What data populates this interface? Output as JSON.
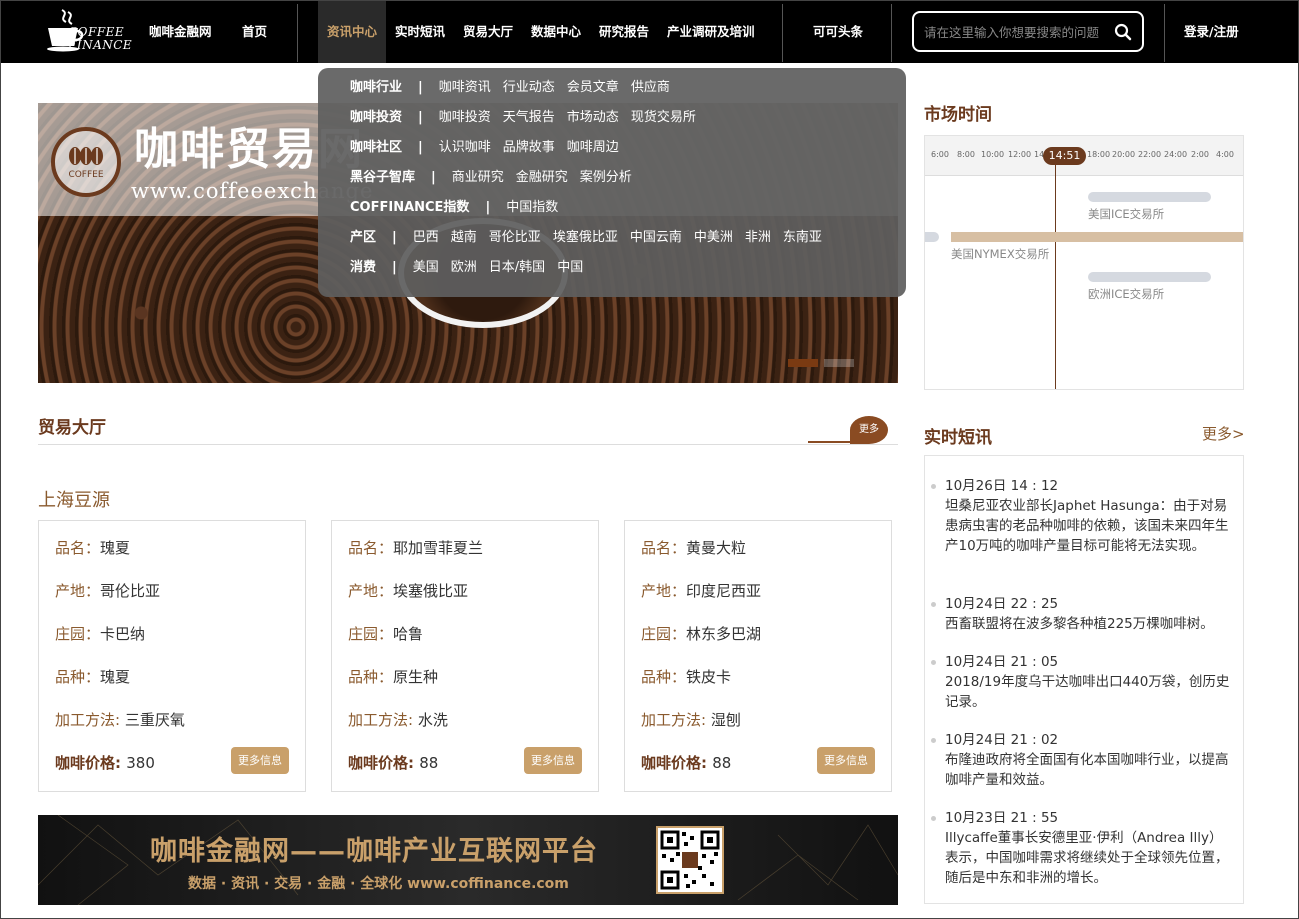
{
  "nav": {
    "logo_line1": "COFFEE",
    "logo_line2": "FINANCE",
    "site_name": "咖啡金融网",
    "home": "首页",
    "news_center": "资讯中心",
    "flash": "实时短讯",
    "trade_hall": "贸易大厅",
    "data_center": "数据中心",
    "research": "研究报告",
    "industry": "产业调研及培训",
    "keke": "可可头条",
    "search_placeholder": "请在这里输入你想要搜索的问题",
    "login": "登录/注册"
  },
  "dropdown": [
    {
      "cat": "咖啡行业",
      "links": [
        "咖啡资讯",
        "行业动态",
        "会员文章",
        "供应商"
      ]
    },
    {
      "cat": "咖啡投资",
      "links": [
        "咖啡投资",
        "天气报告",
        "市场动态",
        "现货交易所"
      ]
    },
    {
      "cat": "咖啡社区",
      "links": [
        "认识咖啡",
        "品牌故事",
        "咖啡周边"
      ]
    },
    {
      "cat": "黑谷子智库",
      "links": [
        "商业研究",
        "金融研究",
        "案例分析"
      ]
    },
    {
      "cat": "COFFINANCE指数",
      "links": [
        "中国指数"
      ]
    },
    {
      "cat": "产区",
      "links": [
        "巴西",
        "越南",
        "哥伦比亚",
        "埃塞俄比亚",
        "中国云南",
        "中美洲",
        "非洲",
        "东南亚"
      ]
    },
    {
      "cat": "消费",
      "links": [
        "美国",
        "欧洲",
        "日本/韩国",
        "中国"
      ]
    }
  ],
  "banner": {
    "title": "咖啡贸易网",
    "url": "www.coffeeexchange",
    "logo_text": "COFFEE"
  },
  "market_time": {
    "title": "市场时间",
    "ticks": [
      "6:00",
      "8:00",
      "10:00",
      "12:00",
      "14",
      "18:00",
      "20:00",
      "22:00",
      "24:00",
      "2:00",
      "4:00"
    ],
    "now": "14:51",
    "exchanges": [
      "美国ICE交易所",
      "美国NYMEX交易所",
      "欧洲ICE交易所"
    ]
  },
  "trade": {
    "title": "贸易大厅",
    "more": "更多",
    "subtitle": "上海豆源",
    "labels": {
      "name": "品名：",
      "origin": "产地：",
      "estate": "庄园：",
      "variety": "品种：",
      "process": "加工方法: ",
      "price": "咖啡价格: ",
      "more_btn": "更多信息"
    },
    "cards": [
      {
        "name": "瑰夏",
        "origin": "哥伦比亚",
        "estate": "卡巴纳",
        "variety": "瑰夏",
        "process": "三重厌氧",
        "price": "380"
      },
      {
        "name": "耶加雪菲夏兰",
        "origin": "埃塞俄比亚",
        "estate": "哈鲁",
        "variety": "原生种",
        "process": "水洗",
        "price": "88"
      },
      {
        "name": "黄曼大粒",
        "origin": "印度尼西亚",
        "estate": "林东多巴湖",
        "variety": "铁皮卡",
        "process": "湿刨",
        "price": "88"
      }
    ]
  },
  "bottom_banner": {
    "title": "咖啡金融网——咖啡产业互联网平台",
    "subtitle": "数据 · 资讯 · 交易 · 金融 · 全球化    www.coffinance.com"
  },
  "news": {
    "title": "实时短讯",
    "more": "更多>",
    "items": [
      {
        "time": "10月26日 14 : 12",
        "text": "坦桑尼亚农业部长Japhet Hasunga：由于对易患病虫害的老品种咖啡的依赖，该国未来四年生产10万吨的咖啡产量目标可能将无法实现。"
      },
      {
        "time": "10月24日 22 : 25",
        "text": "西畜联盟将在波多黎各种植225万棵咖啡树。"
      },
      {
        "time": "10月24日 21 : 05",
        "text": "2018/19年度乌干达咖啡出口440万袋，创历史记录。"
      },
      {
        "time": "10月24日 21 : 02",
        "text": "布隆迪政府将全面国有化本国咖啡行业，以提高咖啡产量和效益。"
      },
      {
        "time": "10月23日 21 : 55",
        "text": "Illycaffe董事长安德里亚·伊利（Andrea Illy）表示，中国咖啡需求将继续处于全球领先位置，随后是中东和非洲的增长。"
      }
    ]
  }
}
